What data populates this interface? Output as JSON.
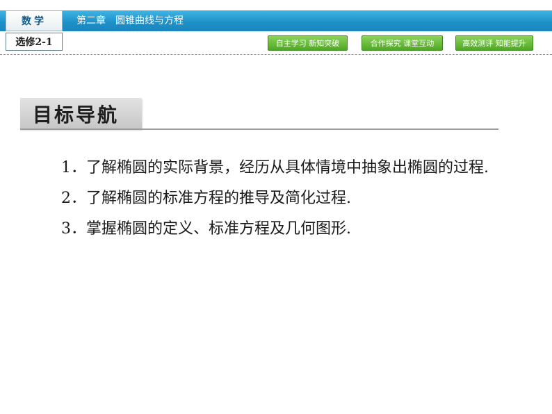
{
  "header": {
    "subject": "数学",
    "chapter": "第二章　圆锥曲线与方程",
    "edition": "选修2-1",
    "nav": [
      "自主学习 新知突破",
      "合作探究 课堂互动",
      "高效测评 知能提升"
    ]
  },
  "section": {
    "title": "目标导航"
  },
  "objectives": [
    {
      "num": "1．",
      "text": "了解椭圆的实际背景，经历从具体情境中抽象出椭圆的过程."
    },
    {
      "num": "2．",
      "text": "了解椭圆的标准方程的推导及简化过程."
    },
    {
      "num": "3．",
      "text": "掌握椭圆的定义、标准方程及几何图形."
    }
  ]
}
